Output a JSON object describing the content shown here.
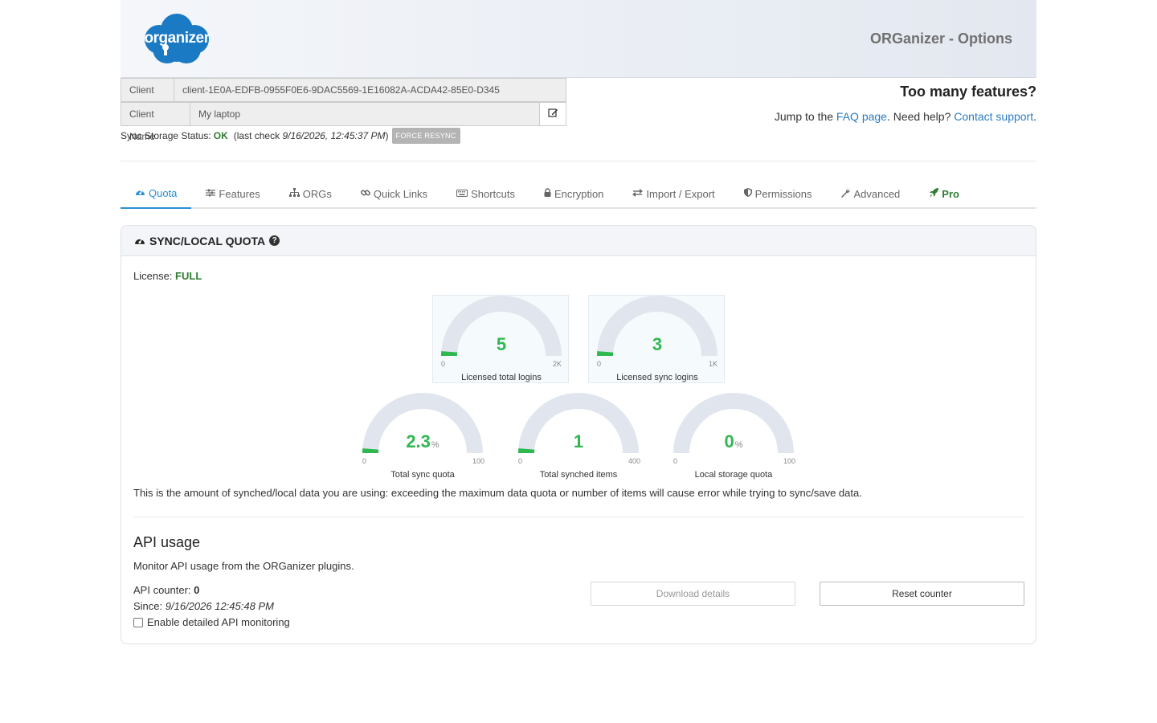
{
  "header": {
    "logo_text": "organizer",
    "title": "ORGanizer - Options"
  },
  "client": {
    "id_label": "Client ID",
    "id_value": "client-1E0A-EDFB-0955F0E6-9DAC5569-1E16082A-ACDA42-85E0-D345",
    "name_label": "Client Name",
    "name_value": "My laptop"
  },
  "sync": {
    "label": "Sync Storage Status:",
    "status": "OK",
    "check_prefix": "(last check",
    "check_time": "9/16/2026, 12:45:37 PM",
    "check_suffix": ")",
    "force_label": "FORCE RESYNC"
  },
  "help": {
    "title": "Too many features?",
    "jump_text": "Jump to the",
    "faq_link": "FAQ page",
    "need_help": ". Need help?",
    "contact_link": "Contact support",
    "end": "."
  },
  "tabs": [
    {
      "label": "Quota",
      "icon": "dashboard-icon"
    },
    {
      "label": "Features",
      "icon": "sliders-icon"
    },
    {
      "label": "ORGs",
      "icon": "sitemap-icon"
    },
    {
      "label": "Quick Links",
      "icon": "link-icon"
    },
    {
      "label": "Shortcuts",
      "icon": "keyboard-icon"
    },
    {
      "label": "Encryption",
      "icon": "lock-icon"
    },
    {
      "label": "Import / Export",
      "icon": "exchange-icon"
    },
    {
      "label": "Permissions",
      "icon": "shield-icon"
    },
    {
      "label": "Advanced",
      "icon": "wrench-icon"
    },
    {
      "label": "Pro",
      "icon": "rocket-icon"
    }
  ],
  "panel": {
    "title": "SYNC/LOCAL QUOTA",
    "license_label": "License:",
    "license_value": "FULL",
    "description": "This is the amount of synched/local data you are using: exceeding the maximum data quota or number of items will cause error while trying to sync/save data."
  },
  "gauges": [
    {
      "label": "Licensed total logins",
      "value": "5",
      "unit": "",
      "min": "0",
      "max": "2K",
      "fraction": 0.0025,
      "fill_color": "#2fb84f"
    },
    {
      "label": "Licensed sync logins",
      "value": "3",
      "unit": "",
      "min": "0",
      "max": "1K",
      "fraction": 0.003,
      "fill_color": "#2fb84f"
    },
    {
      "label": "Total sync quota",
      "value": "2.3",
      "unit": "%",
      "min": "0",
      "max": "100",
      "fraction": 0.023,
      "fill_color": "#2fb84f"
    },
    {
      "label": "Total synched items",
      "value": "1",
      "unit": "",
      "min": "0",
      "max": "400",
      "fraction": 0.0025,
      "fill_color": "#2fb84f"
    },
    {
      "label": "Local storage quota",
      "value": "0",
      "unit": "%",
      "min": "0",
      "max": "100",
      "fraction": 0,
      "fill_color": "#2fb84f"
    }
  ],
  "api": {
    "title": "API usage",
    "description": "Monitor API usage from the ORGanizer plugins.",
    "counter_label": "API counter:",
    "counter_value": "0",
    "since_label": "Since:",
    "since_value": "9/16/2026 12:45:48 PM",
    "monitor_label": "Enable detailed API monitoring",
    "download_label": "Download details",
    "reset_label": "Reset counter"
  },
  "colors": {
    "accent": "#2a8fd6",
    "success": "#2fb84f",
    "ok_text": "#2e7d32",
    "logo_blue": "#1b7ac4",
    "gauge_track": "#e1e6ee"
  }
}
